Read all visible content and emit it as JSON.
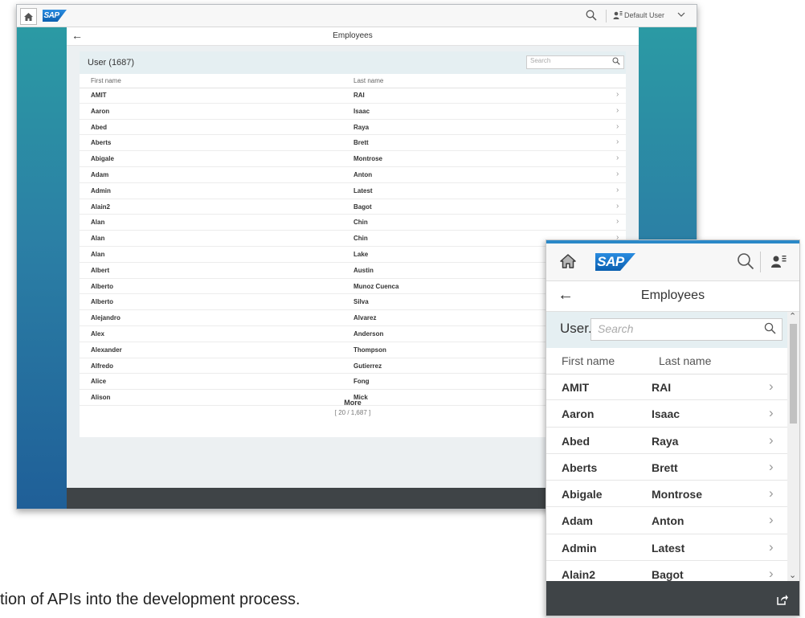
{
  "desktop": {
    "brand": "SAP",
    "user_label": "Default User",
    "page_title": "Employees",
    "table_title": "User (1687)",
    "search_placeholder": "Search",
    "columns": [
      "First name",
      "Last name"
    ],
    "rows": [
      {
        "first": "AMIT",
        "last": "RAI"
      },
      {
        "first": "Aaron",
        "last": "Isaac"
      },
      {
        "first": "Abed",
        "last": "Raya"
      },
      {
        "first": "Aberts",
        "last": "Brett"
      },
      {
        "first": "Abigale",
        "last": "Montrose"
      },
      {
        "first": "Adam",
        "last": "Anton"
      },
      {
        "first": "Admin",
        "last": "Latest"
      },
      {
        "first": "Alain2",
        "last": "Bagot"
      },
      {
        "first": "Alan",
        "last": "Chin"
      },
      {
        "first": "Alan",
        "last": "Chin"
      },
      {
        "first": "Alan",
        "last": "Lake"
      },
      {
        "first": "Albert",
        "last": "Austin"
      },
      {
        "first": "Alberto",
        "last": "Munoz Cuenca"
      },
      {
        "first": "Alberto",
        "last": "Silva"
      },
      {
        "first": "Alejandro",
        "last": "Alvarez"
      },
      {
        "first": "Alex",
        "last": "Anderson"
      },
      {
        "first": "Alexander",
        "last": "Thompson"
      },
      {
        "first": "Alfredo",
        "last": "Gutierrez"
      },
      {
        "first": "Alice",
        "last": "Fong"
      },
      {
        "first": "Alison",
        "last": "Mick"
      }
    ],
    "more_label": "More",
    "count_label": "[ 20 / 1,687 ]"
  },
  "mobile": {
    "brand": "SAP",
    "page_title": "Employees",
    "table_title": "User...",
    "search_placeholder": "Search",
    "columns": [
      "First name",
      "Last name"
    ],
    "rows": [
      {
        "first": "AMIT",
        "last": "RAI"
      },
      {
        "first": "Aaron",
        "last": "Isaac"
      },
      {
        "first": "Abed",
        "last": "Raya"
      },
      {
        "first": "Aberts",
        "last": "Brett"
      },
      {
        "first": "Abigale",
        "last": "Montrose"
      },
      {
        "first": "Adam",
        "last": "Anton"
      },
      {
        "first": "Admin",
        "last": "Latest"
      },
      {
        "first": "Alain2",
        "last": "Bagot"
      }
    ]
  },
  "caption": "tion of APIs into the development process.",
  "icons": {
    "home": "home-icon",
    "search": "search-icon",
    "user": "user-icon",
    "back": "back-arrow-icon",
    "chevron": "chevron-right-icon",
    "share": "share-icon"
  },
  "colors": {
    "accent": "#2a88c8",
    "background_gradient_top": "#2b9aa4",
    "background_gradient_bottom": "#1f5f98",
    "footer": "#3f4447",
    "table_header": "#e5eff2"
  }
}
